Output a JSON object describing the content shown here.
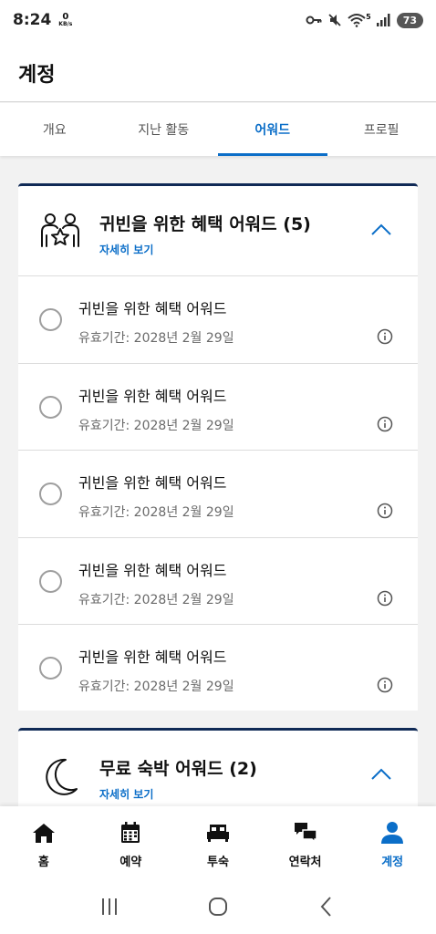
{
  "status_bar": {
    "time": "8:24",
    "net_speed_value": "0",
    "net_speed_unit": "KB/s",
    "battery": "73",
    "signal_label": "5"
  },
  "header": {
    "title": "계정"
  },
  "tabs": [
    {
      "label": "개요",
      "active": false
    },
    {
      "label": "지난 활동",
      "active": false
    },
    {
      "label": "어워드",
      "active": true
    },
    {
      "label": "프로필",
      "active": false
    }
  ],
  "award_groups": [
    {
      "icon": "vip-people-icon",
      "title": "귀빈을 위한 혜택 어워드 (5)",
      "link": "자세히 보기",
      "expanded": true,
      "items": [
        {
          "name": "귀빈을 위한 혜택 어워드",
          "validity": "유효기간: 2028년 2월 29일"
        },
        {
          "name": "귀빈을 위한 혜택 어워드",
          "validity": "유효기간: 2028년 2월 29일"
        },
        {
          "name": "귀빈을 위한 혜택 어워드",
          "validity": "유효기간: 2028년 2월 29일"
        },
        {
          "name": "귀빈을 위한 혜택 어워드",
          "validity": "유효기간: 2028년 2월 29일"
        },
        {
          "name": "귀빈을 위한 혜택 어워드",
          "validity": "유효기간: 2028년 2월 29일"
        }
      ]
    },
    {
      "icon": "moon-icon",
      "title": "무료 숙박 어워드 (2)",
      "link": "자세히 보기",
      "expanded": true
    }
  ],
  "bottom_nav": [
    {
      "label": "홈",
      "icon": "home-icon",
      "active": false
    },
    {
      "label": "예약",
      "icon": "calendar-icon",
      "active": false
    },
    {
      "label": "투숙",
      "icon": "bed-icon",
      "active": false
    },
    {
      "label": "연락처",
      "icon": "chat-icon",
      "active": false
    },
    {
      "label": "계정",
      "icon": "person-icon",
      "active": true
    }
  ],
  "colors": {
    "accent": "#0b6ec8",
    "card_top_border": "#102a56",
    "background": "#f2f2f2"
  }
}
